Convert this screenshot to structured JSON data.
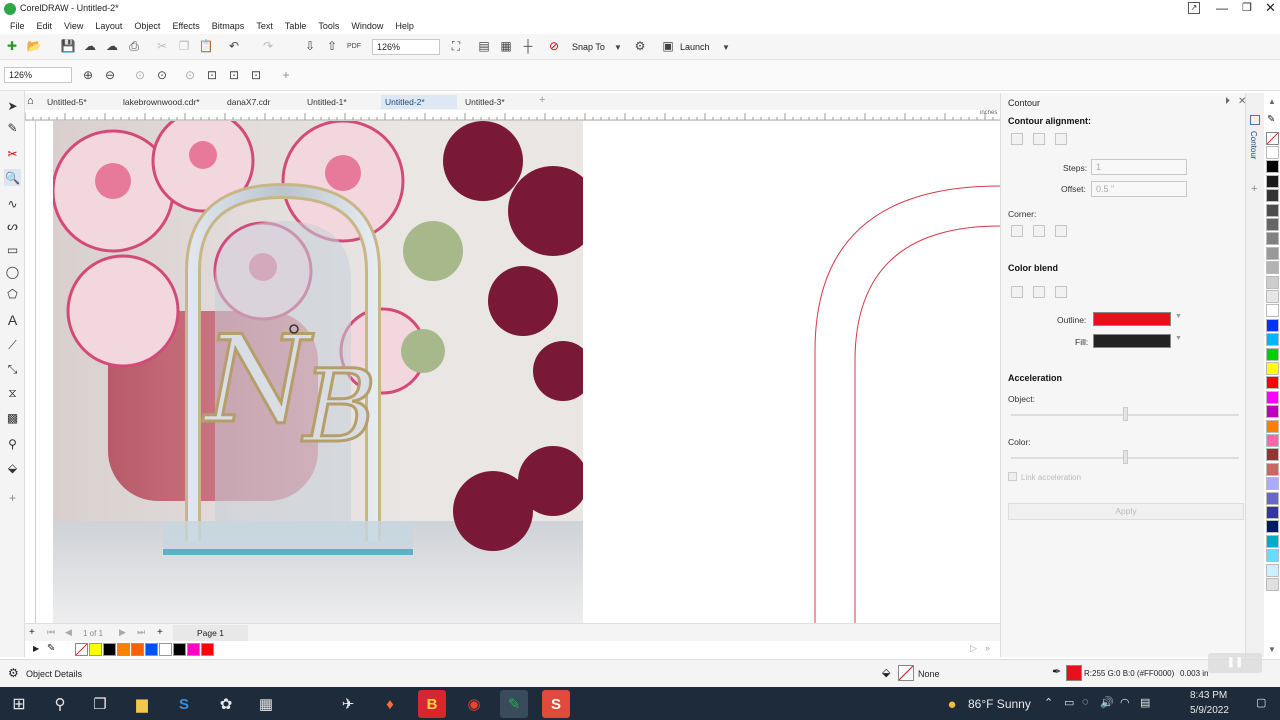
{
  "title_bar": {
    "app_title": "CorelDRAW - Untitled-2*"
  },
  "menu": [
    "File",
    "Edit",
    "View",
    "Layout",
    "Object",
    "Effects",
    "Bitmaps",
    "Text",
    "Table",
    "Tools",
    "Window",
    "Help"
  ],
  "toolbar": {
    "pdf_label": "PDF",
    "zoom_value": "126%",
    "snap_to": "Snap To",
    "launch": "Launch"
  },
  "propbar": {
    "zoom_value": "126%"
  },
  "doc_tabs": [
    "Untitled-5*",
    "lakebrownwood.cdr*",
    "danaX7.cdr",
    "Untitled-1*",
    "Untitled-2*",
    "Untitled-3*"
  ],
  "active_doc_tab": "Untitled-2*",
  "ruler": {
    "unit": "inches"
  },
  "page_nav": {
    "count": "1 of 1",
    "page_tab": "Page 1"
  },
  "docker": {
    "title": "Contour",
    "side_tab": "Contour",
    "alignment_label": "Contour alignment:",
    "steps_label": "Steps:",
    "steps_value": "1",
    "offset_label": "Offset:",
    "offset_value": "0.5 \"",
    "corner_label": "Corner:",
    "color_blend_label": "Color blend",
    "outline_label": "Outline:",
    "outline_color": "#e8101a",
    "fill_label": "Fill:",
    "fill_color": "#222222",
    "acceleration_label": "Acceleration",
    "object_label": "Object:",
    "color_label": "Color:",
    "link_accel_label": "Link acceleration",
    "apply_label": "Apply"
  },
  "status": {
    "object_details": "Object Details",
    "fill_label": "None",
    "outline_readout": "R:255 G:0 B:0 (#FF0000)",
    "outline_width": "0.003 in"
  },
  "taskbar": {
    "weather": "86°F  Sunny",
    "time": "8:43 PM",
    "date": "5/9/2022"
  },
  "bottom_palette": [
    "#ffff00",
    "#000000",
    "#ff8000",
    "#ff6000",
    "#0050ff",
    "#ffffff",
    "#000000",
    "#ff00c8",
    "#ff0000"
  ],
  "right_palette": [
    "#ffffff",
    "#000000",
    "#1a1a1a",
    "#333333",
    "#4d4d4d",
    "#666666",
    "#808080",
    "#999999",
    "#b3b3b3",
    "#cccccc",
    "#e6e6e6",
    "#ffffff",
    "#0033ff",
    "#00b4ff",
    "#00d000",
    "#ffff00",
    "#ff0000",
    "#ff00ff",
    "#c000c0",
    "#ff8000",
    "#ff66aa",
    "#993333",
    "#cc6666",
    "#aaaaff",
    "#6666cc",
    "#3333aa",
    "#001a66",
    "#00aacc",
    "#66ddff",
    "#ccf0ff",
    "#e0e0e0"
  ]
}
